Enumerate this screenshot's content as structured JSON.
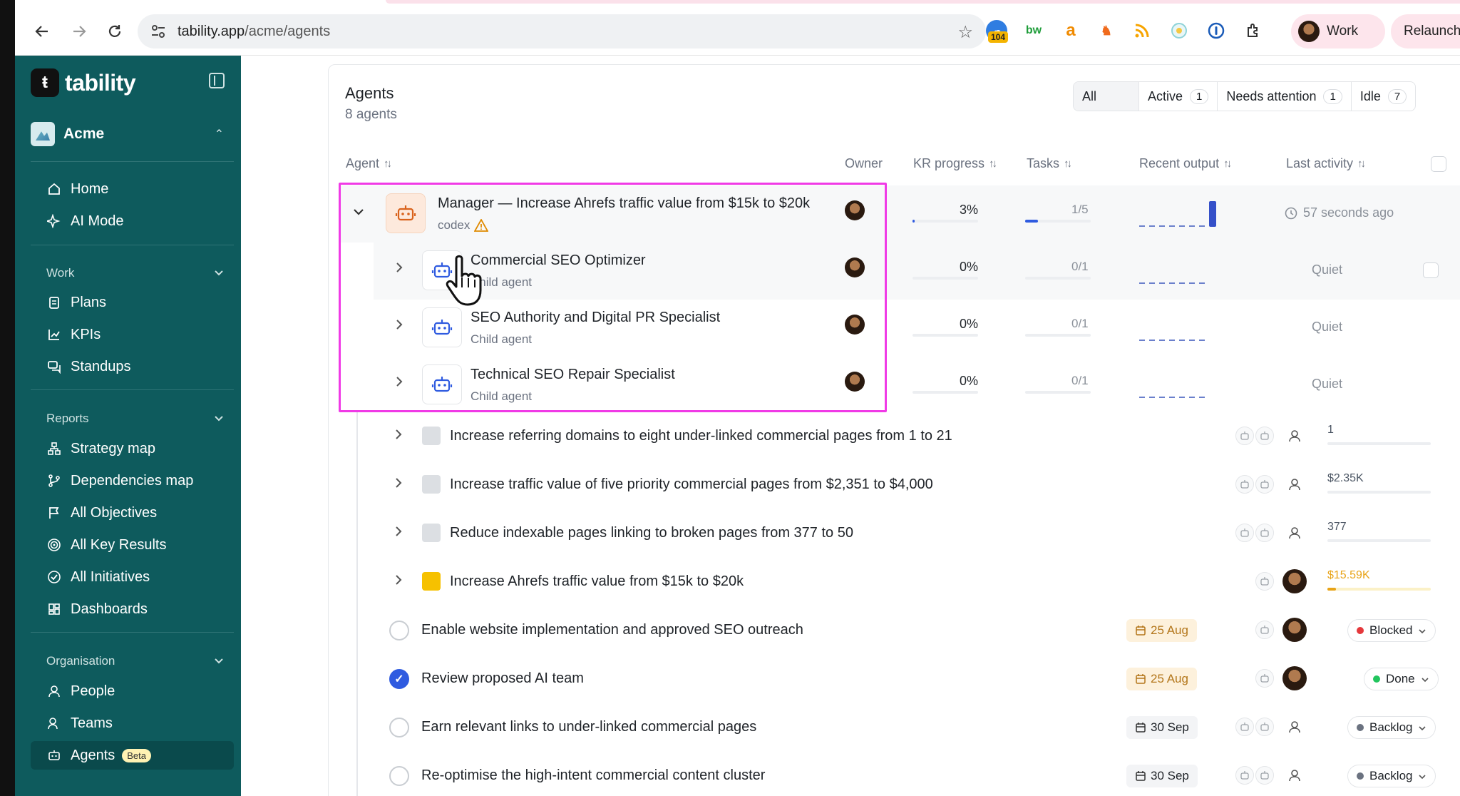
{
  "browser": {
    "url_host": "tability.app",
    "url_path": "/acme/agents",
    "ext_badge": "104",
    "profile_label": "Work",
    "relaunch_label": "Relaunch to"
  },
  "sidebar": {
    "brand": "tability",
    "workspace": "Acme",
    "primary": [
      {
        "label": "Home",
        "icon": "home-icon"
      },
      {
        "label": "AI Mode",
        "icon": "sparkle-icon"
      }
    ],
    "work_section": "Work",
    "work_items": [
      {
        "label": "Plans",
        "icon": "clipboard-icon"
      },
      {
        "label": "KPIs",
        "icon": "chart-line-icon"
      },
      {
        "label": "Standups",
        "icon": "chat-icon"
      }
    ],
    "reports_section": "Reports",
    "reports_items": [
      {
        "label": "Strategy map",
        "icon": "sitemap-icon"
      },
      {
        "label": "Dependencies map",
        "icon": "branch-icon"
      },
      {
        "label": "All Objectives",
        "icon": "flag-icon"
      },
      {
        "label": "All Key Results",
        "icon": "target-icon"
      },
      {
        "label": "All Initiatives",
        "icon": "check-circle-icon"
      },
      {
        "label": "Dashboards",
        "icon": "grid-icon"
      }
    ],
    "org_section": "Organisation",
    "org_items": [
      {
        "label": "People",
        "icon": "person-icon"
      },
      {
        "label": "Teams",
        "icon": "team-icon"
      },
      {
        "label": "Agents",
        "icon": "robot-icon",
        "badge": "Beta",
        "active": true
      }
    ]
  },
  "page": {
    "title": "Agents",
    "subtitle": "8 agents",
    "filters": [
      {
        "label": "All",
        "count": ""
      },
      {
        "label": "Active",
        "count": "1"
      },
      {
        "label": "Needs attention",
        "count": "1"
      },
      {
        "label": "Idle",
        "count": "7"
      }
    ]
  },
  "table": {
    "headers": {
      "agent": "Agent",
      "owner": "Owner",
      "kr_progress": "KR progress",
      "tasks": "Tasks",
      "recent_output": "Recent output",
      "last_activity": "Last activity"
    },
    "manager": {
      "name": "Manager — Increase Ahrefs traffic value from $15k to $20k",
      "sub": "codex",
      "kr_progress": "3%",
      "kr_fraction": 0.03,
      "tasks": "1/5",
      "tasks_fraction": 0.2,
      "last_activity": "57 seconds ago"
    },
    "children": [
      {
        "name": "Commercial SEO Optimizer",
        "sub": "Child agent",
        "kr_progress": "0%",
        "tasks": "0/1",
        "last_activity": "Quiet"
      },
      {
        "name": "SEO Authority and Digital PR Specialist",
        "sub": "Child agent",
        "kr_progress": "0%",
        "tasks": "0/1",
        "last_activity": "Quiet"
      },
      {
        "name": "Technical SEO Repair Specialist",
        "sub": "Child agent",
        "kr_progress": "0%",
        "tasks": "0/1",
        "last_activity": "Quiet"
      }
    ],
    "key_results": [
      {
        "title": "Increase referring domains to eight under-linked commercial pages from 1 to 21",
        "value": "1",
        "fraction": 0
      },
      {
        "title": "Increase traffic value of five priority commercial pages from $2,351 to $4,000",
        "value": "$2.35K",
        "fraction": 0
      },
      {
        "title": "Reduce indexable pages linking to broken pages from 377 to 50",
        "value": "377",
        "fraction": 0
      },
      {
        "title": "Increase Ahrefs traffic value from $15k to $20k",
        "value": "$15.59K",
        "fraction": 0.08,
        "color": "#e8a317"
      }
    ],
    "initiatives": [
      {
        "title": "Enable website implementation and approved SEO outreach",
        "date": "25 Aug",
        "status": "Blocked",
        "status_color": "#e5383b",
        "done": false
      },
      {
        "title": "Review proposed AI team",
        "date": "25 Aug",
        "status": "Done",
        "status_color": "#22c55e",
        "done": true
      },
      {
        "title": "Earn relevant links to under-linked commercial pages",
        "date": "30 Sep",
        "status": "Backlog",
        "status_color": "#6b7280",
        "done": false
      },
      {
        "title": "Re-optimise the high-intent commercial content cluster",
        "date": "30 Sep",
        "status": "Backlog",
        "status_color": "#6b7280",
        "done": false
      }
    ]
  },
  "colors": {
    "sidebar": "#0e5b5d",
    "accent": "#2f5be0",
    "highlight": "#f03ae6"
  }
}
